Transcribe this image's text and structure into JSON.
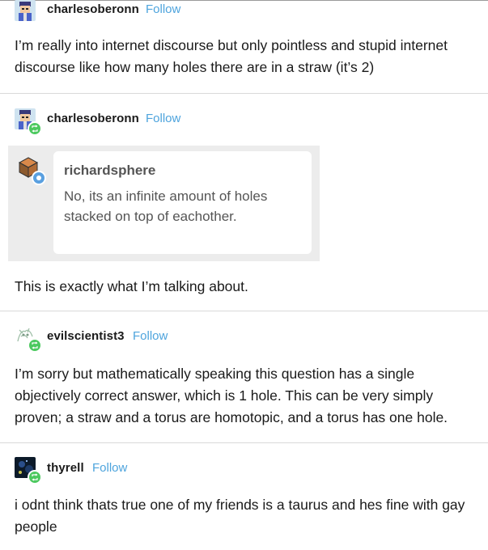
{
  "posts": [
    {
      "username": "charlesoberonn",
      "follow_label": "Follow",
      "avatar_icon": "pixel-avatar-icon",
      "text": "I’m really into internet discourse but only pointless and stupid internet discourse like how many holes there are in a straw (it’s 2)"
    },
    {
      "username": "charlesoberonn",
      "follow_label": "Follow",
      "avatar_icon": "pixel-avatar-icon",
      "quote": {
        "username": "richardsphere",
        "avatar_icon": "cube-avatar-icon",
        "text": "No, its an infinite amount of holes stacked on top of eachother."
      },
      "text": "This is exactly what I’m talking about."
    },
    {
      "username": "evilscientist3",
      "follow_label": "Follow",
      "avatar_icon": "sketch-avatar-icon",
      "text": "I’m sorry but mathematically speaking this question has a single objectively correct answer, which is 1 hole. This can be very simply proven; a straw and a torus are homotopic, and a torus has one hole."
    },
    {
      "username": "thyrell",
      "follow_label": "Follow",
      "avatar_icon": "dark-avatar-icon",
      "text": "i odnt think thats true one of my friends is a taurus and hes fine with gay people"
    }
  ],
  "colors": {
    "follow": "#4ea4dd",
    "reblog_badge": "#4cc95f",
    "quote_panel": "#ececec",
    "divider": "#d9d9d9"
  }
}
